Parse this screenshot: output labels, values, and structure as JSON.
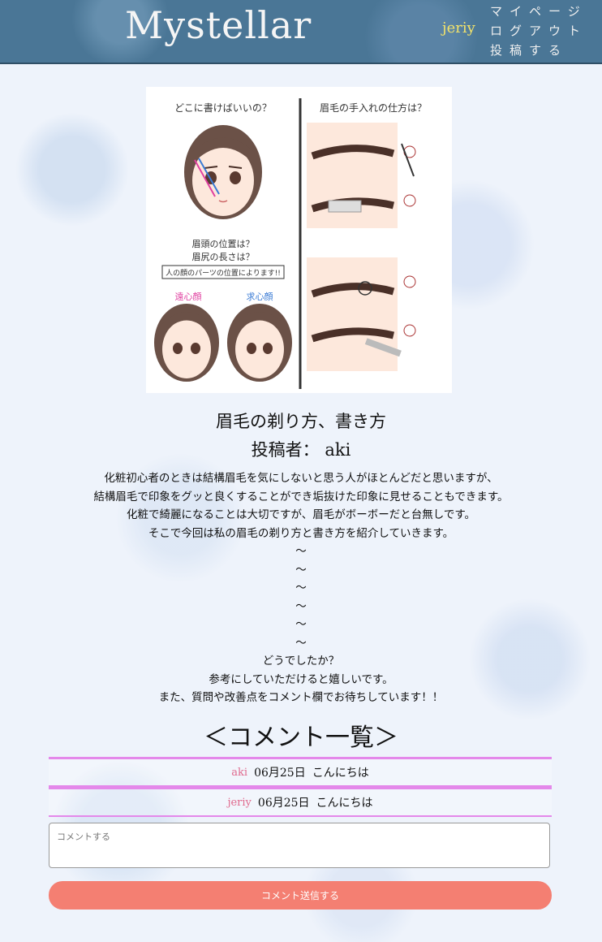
{
  "header": {
    "logo": "Mystellar",
    "username": "jeriy",
    "nav": [
      "マイページ",
      "ログアウト",
      "投稿する"
    ]
  },
  "article": {
    "image_texts": {
      "left_top": "どこに書けばいいの？",
      "right_top": "眉毛の手入れの仕方は？",
      "left_mid1": "眉頭の位置は？",
      "left_mid2": "眉尻の長さは？",
      "left_banner": "人の顔のパーツの位置によります!!",
      "face_left": "遠心顔",
      "face_right": "求心顔"
    },
    "title": "眉毛の剃り方、書き方",
    "author_label": "投稿者：",
    "author": "aki",
    "body_lines": [
      "化粧初心者のときは結構眉毛を気にしないと思う人がほとんどだと思いますが、",
      "結構眉毛で印象をグッと良くすることができ垢抜けた印象に見せることもできます。",
      "化粧で綺麗になることは大切ですが、眉毛がボーボーだと台無しです。",
      "そこで今回は私の眉毛の剃り方と書き方を紹介していきます。",
      "〜",
      "〜",
      "〜",
      "〜",
      "〜",
      "〜",
      "どうでしたか？",
      "参考にしていただけると嬉しいです。",
      "また、質問や改善点をコメント欄でお待ちしています！！"
    ]
  },
  "comments": {
    "heading": "＜コメント一覧＞",
    "items": [
      {
        "user": "aki",
        "date": "06月25日",
        "text": "こんにちは"
      },
      {
        "user": "jeriy",
        "date": "06月25日",
        "text": "こんにちは"
      }
    ],
    "placeholder": "コメントする",
    "submit_label": "コメント送信する"
  },
  "colors": {
    "header_bg": "#4a7696",
    "username": "#f3e36a",
    "comment_border": "#e488ea",
    "comment_user": "#e06a8e",
    "submit_bg": "#f47f72"
  }
}
